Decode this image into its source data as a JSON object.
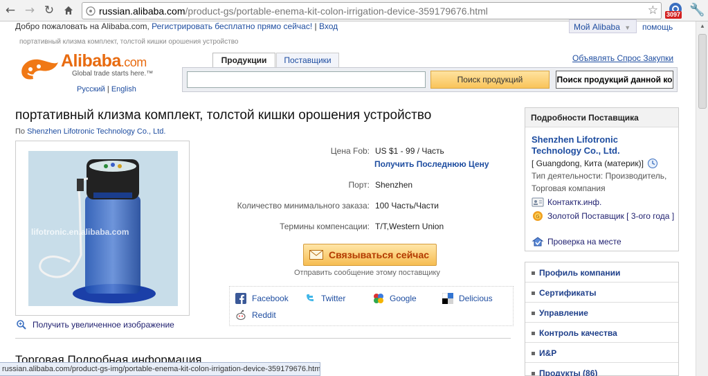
{
  "browser": {
    "url_host": "russian.alibaba.com",
    "url_path": "/product-gs/portable-enema-kit-colon-irrigation-device-359179676.html",
    "extension_badge": "3097"
  },
  "topbar": {
    "welcome": "Добро пожаловать на Alibaba.com,",
    "register": "Регистрировать бесплатно прямо сейчас!",
    "separator": "|",
    "login": "Вход",
    "my_alibaba": "Мой Alibaba",
    "help": "помощь"
  },
  "breadcrumb_title": "портативный клизма комплект, толстой кишки орошения устройство",
  "logo": {
    "name": "Alibaba",
    "suffix": ".com",
    "tagline": "Global trade starts here.™",
    "lang_ru": "Русский",
    "lang_sep": "|",
    "lang_en": "English"
  },
  "search": {
    "tab_products": "Продукции",
    "tab_suppliers": "Поставщики",
    "post_request": "Объявлять Спрос Закупки",
    "input_value": "",
    "search_button": "Поиск продукций",
    "search_store_button": "Поиск продукций данной ко"
  },
  "product": {
    "title": "портативный клизма комплект, толстой кишки орошения устройство",
    "by_prefix": "По",
    "supplier": "Shenzhen Lifotronic Technology Co., Ltd.",
    "watermark": "lifotronic.en.alibaba.com",
    "zoom_label": "Получить увеличенное изображение",
    "specs": [
      {
        "label": "Цена Fob:",
        "value": "US $1 - 99 / Часть"
      },
      {
        "label": "Порт:",
        "value": "Shenzhen"
      },
      {
        "label": "Количество минимального заказа:",
        "value": "100 Часть/Части"
      },
      {
        "label": "Термины компенсации:",
        "value": "T/T,Western Union"
      }
    ],
    "latest_price": "Получить Последнюю Цену",
    "contact_button": "Связываться сейчас",
    "contact_sub": "Отправить сообщение этому поставщику",
    "share": {
      "facebook": "Facebook",
      "twitter": "Twitter",
      "google": "Google",
      "delicious": "Delicious",
      "reddit": "Reddit"
    },
    "trade_detail": "Торговая Подробная информация"
  },
  "supplier_panel": {
    "heading": "Подробности Поставщика",
    "name": "Shenzhen Lifotronic Technology Co., Ltd.",
    "location": "[ Guangdong, Китa (материк)]",
    "business_type": "Тип деятельности: Производитель, Торговая компания",
    "contact": "Контактк.инф.",
    "gold_supplier": "Золотой Поставщик [ 3-ого года ]",
    "onsite_check": "Проверка на месте"
  },
  "side_menu": [
    "Профиль компании",
    "Сертификаты",
    "Управление",
    "Контроль качества",
    "И&Р",
    "Продукты (86)"
  ],
  "status_bar": "russian.alibaba.com/product-gs-img/portable-enema-kit-colon-irrigation-device-359179676.html"
}
